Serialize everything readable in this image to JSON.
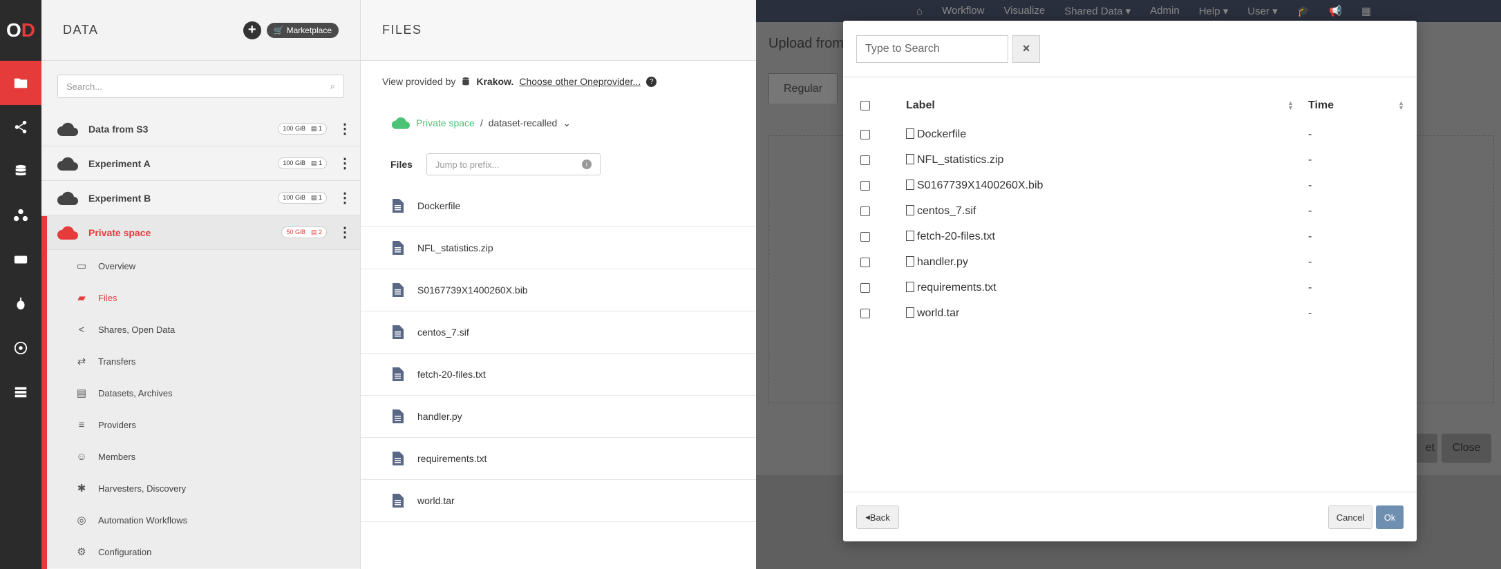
{
  "app": {
    "logo_text": "O",
    "logo_text_2": "D"
  },
  "rail": {
    "items": [
      {
        "icon": "folder-icon",
        "active": true
      },
      {
        "icon": "share-icon"
      },
      {
        "icon": "database-icon"
      },
      {
        "icon": "groups-icon"
      },
      {
        "icon": "tokens-icon"
      },
      {
        "icon": "bug-icon"
      },
      {
        "icon": "workflow-icon"
      },
      {
        "icon": "list-icon"
      }
    ]
  },
  "sidebar": {
    "title": "DATA",
    "marketplace_label": "Marketplace",
    "search_placeholder": "Search...",
    "spaces": [
      {
        "name": "Data from S3",
        "size": "100 GiB",
        "providers": "1"
      },
      {
        "name": "Experiment A",
        "size": "100 GiB",
        "providers": "1"
      },
      {
        "name": "Experiment B",
        "size": "100 GiB",
        "providers": "1"
      },
      {
        "name": "Private space",
        "size": "50 GiB",
        "providers": "2"
      }
    ],
    "submenu": [
      {
        "label": "Overview",
        "icon": "overview-icon"
      },
      {
        "label": "Files",
        "icon": "folder-icon",
        "active": true
      },
      {
        "label": "Shares, Open Data",
        "icon": "share-icon"
      },
      {
        "label": "Transfers",
        "icon": "transfers-icon"
      },
      {
        "label": "Datasets, Archives",
        "icon": "datasets-icon"
      },
      {
        "label": "Providers",
        "icon": "database-icon"
      },
      {
        "label": "Members",
        "icon": "members-icon"
      },
      {
        "label": "Harvesters, Discovery",
        "icon": "bug-icon"
      },
      {
        "label": "Automation Workflows",
        "icon": "workflow-icon"
      },
      {
        "label": "Configuration",
        "icon": "gear-icon"
      }
    ]
  },
  "files": {
    "title": "FILES",
    "provider_prefix": "View provided by",
    "provider_name": "Krakow",
    "provider_suffix": ".",
    "choose_provider": "Choose other Oneprovider...",
    "help_mark": "?",
    "breadcrumb_space": "Private space",
    "breadcrumb_sep": "/",
    "breadcrumb_dir": "dataset-recalled",
    "files_label": "Files",
    "prefix_placeholder": "Jump to prefix...",
    "info_mark": "i",
    "list": [
      "Dockerfile",
      "NFL_statistics.zip",
      "S0167739X1400260X.bib",
      "centos_7.sif",
      "fetch-20-files.txt",
      "handler.py",
      "requirements.txt",
      "world.tar"
    ]
  },
  "topnav": {
    "items": [
      "Workflow",
      "Visualize",
      "Shared Data ▾",
      "Admin",
      "Help ▾",
      "User ▾"
    ]
  },
  "upload": {
    "title": "Upload from",
    "tab_regular": "Regular",
    "reset_fragment": "et",
    "close_label": "Close"
  },
  "modal": {
    "search_placeholder": "Type to Search",
    "clear_label": "×",
    "col_label": "Label",
    "col_time": "Time",
    "rows": [
      {
        "label": "Dockerfile",
        "time": "-"
      },
      {
        "label": "NFL_statistics.zip",
        "time": "-"
      },
      {
        "label": "S0167739X1400260X.bib",
        "time": "-"
      },
      {
        "label": "centos_7.sif",
        "time": "-"
      },
      {
        "label": "fetch-20-files.txt",
        "time": "-"
      },
      {
        "label": "handler.py",
        "time": "-"
      },
      {
        "label": "requirements.txt",
        "time": "-"
      },
      {
        "label": "world.tar",
        "time": "-"
      }
    ],
    "back_label": "Back",
    "cancel_label": "Cancel",
    "ok_label": "Ok"
  }
}
